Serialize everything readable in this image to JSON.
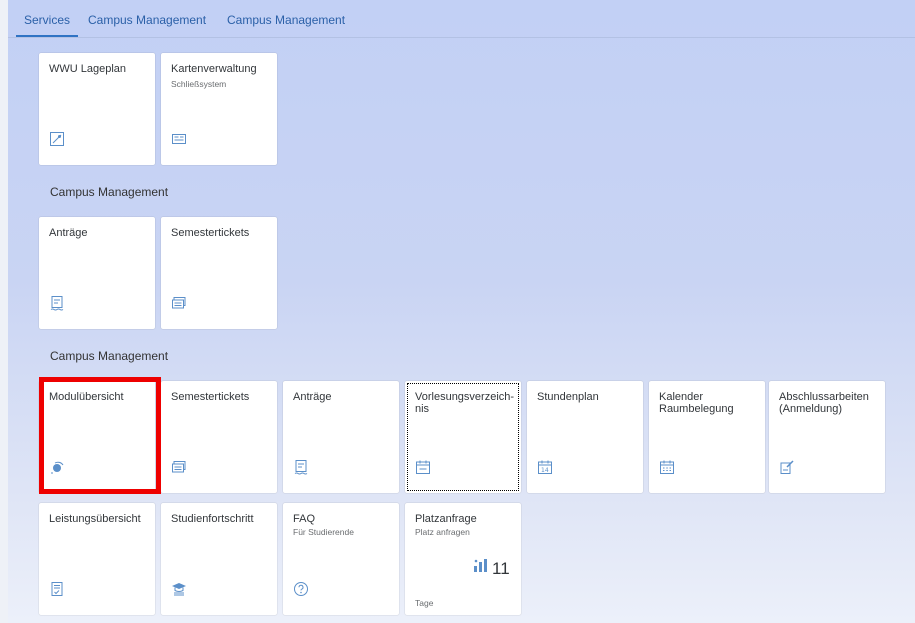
{
  "tabs": [
    "Services",
    "Campus Management",
    "Campus Management"
  ],
  "sections": [
    "Campus Management",
    "Campus Management"
  ],
  "group0": [
    {
      "title": "WWU Lageplan",
      "subtitle": "",
      "icon": "map-icon"
    },
    {
      "title": "Kartenverwaltung",
      "subtitle": "Schließsystem",
      "icon": "card-icon"
    }
  ],
  "group1": [
    {
      "title": "Anträge",
      "subtitle": "",
      "icon": "document-icon"
    },
    {
      "title": "Semestertickets",
      "subtitle": "",
      "icon": "tickets-icon"
    }
  ],
  "group2": [
    {
      "title": "Modulübersicht",
      "subtitle": "",
      "icon": "module-overview-icon"
    },
    {
      "title": "Semestertickets",
      "subtitle": "",
      "icon": "tickets-icon"
    },
    {
      "title": "Anträge",
      "subtitle": "",
      "icon": "document-icon"
    },
    {
      "title": "Vorlesungsverzeich-nis",
      "subtitle": "",
      "icon": "calendar-icon"
    },
    {
      "title": "Stundenplan",
      "subtitle": "",
      "icon": "calendar-14-icon"
    },
    {
      "title": "Kalender Raumbelegung",
      "subtitle": "",
      "icon": "calendar-grid-icon"
    },
    {
      "title": "Abschlussarbeiten (Anmeldung)",
      "subtitle": "",
      "icon": "edit-document-icon"
    },
    {
      "title": "Leistungsübersicht",
      "subtitle": "",
      "icon": "checklist-icon"
    },
    {
      "title": "Studienfortschritt",
      "subtitle": "",
      "icon": "education-icon"
    },
    {
      "title": "FAQ",
      "subtitle": "Für Studierende",
      "icon": "question-icon"
    },
    {
      "title": "Platzanfrage",
      "subtitle": "Platz anfragen",
      "icon": "bar-chart-icon",
      "kpi_value": "11",
      "kpi_unit": "Tage"
    }
  ],
  "colors": {
    "accent": "#2b60a8",
    "icon": "#5b8fc9",
    "highlight": "#ee0000"
  }
}
